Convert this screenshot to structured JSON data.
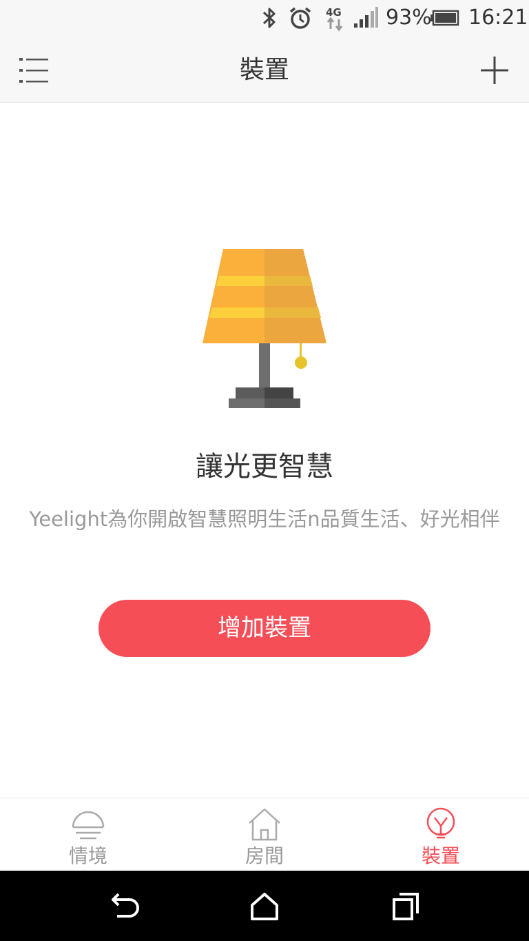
{
  "status_bar": {
    "battery_percent": "93%",
    "time": "16:21",
    "network": "4G",
    "icons": [
      "bluetooth-icon",
      "alarm-icon",
      "network-4g-icon",
      "signal-icon",
      "battery-icon"
    ]
  },
  "app_bar": {
    "title": "裝置",
    "menu_icon": "menu-icon",
    "add_icon": "plus-icon"
  },
  "main": {
    "illustration": "table-lamp-illustration",
    "headline": "讓光更智慧",
    "subline": "Yeelight為你開啟智慧照明生活n品質生活、好光相伴",
    "add_button_label": "增加裝置"
  },
  "tabs": [
    {
      "label": "情境",
      "icon": "scene-lamp-icon",
      "active": false
    },
    {
      "label": "房間",
      "icon": "house-icon",
      "active": false
    },
    {
      "label": "裝置",
      "icon": "bulb-icon",
      "active": true
    }
  ],
  "nav_bar": {
    "icons": [
      "back-icon",
      "home-icon",
      "recents-icon"
    ]
  },
  "colors": {
    "accent": "#f54e57",
    "header_bg": "#f7f7f7",
    "muted_text": "#999999"
  }
}
